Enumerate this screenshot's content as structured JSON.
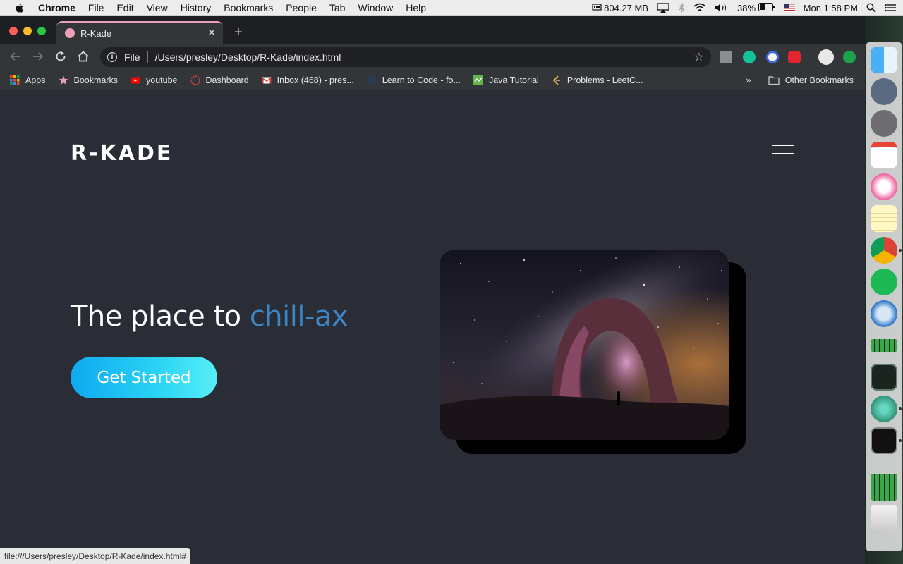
{
  "menubar": {
    "app": "Chrome",
    "items": [
      "File",
      "Edit",
      "View",
      "History",
      "Bookmarks",
      "People",
      "Tab",
      "Window",
      "Help"
    ],
    "memory": "804.27 MB",
    "battery": "38%",
    "clock": "Mon 1:58 PM"
  },
  "tab": {
    "title": "R-Kade"
  },
  "omnibox": {
    "scheme": "File",
    "path": "/Users/presley/Desktop/R-Kade/index.html"
  },
  "bookmarks": {
    "items": [
      {
        "label": "Apps",
        "icon": "apps-grid-icon"
      },
      {
        "label": "Bookmarks",
        "icon": "star-icon"
      },
      {
        "label": "youtube",
        "icon": "youtube-icon"
      },
      {
        "label": "Dashboard",
        "icon": "dashboard-icon"
      },
      {
        "label": "Inbox (468) - pres...",
        "icon": "gmail-icon"
      },
      {
        "label": "Learn to Code - fo...",
        "icon": "freecodecamp-icon"
      },
      {
        "label": "Java Tutorial",
        "icon": "java-icon"
      },
      {
        "label": "Problems - LeetC...",
        "icon": "leetcode-icon"
      }
    ],
    "other": "Other Bookmarks"
  },
  "page": {
    "logo": "R-KADE",
    "headline_prefix": "The place to ",
    "headline_accent": "chill-ax",
    "cta_label": "Get Started"
  },
  "status_url": "file:///Users/presley/Desktop/R-Kade/index.html#",
  "colors": {
    "background": "#2a2d35",
    "accent": "#3d86c6",
    "cta_start": "#0fa8f0",
    "cta_end": "#58eef7"
  }
}
